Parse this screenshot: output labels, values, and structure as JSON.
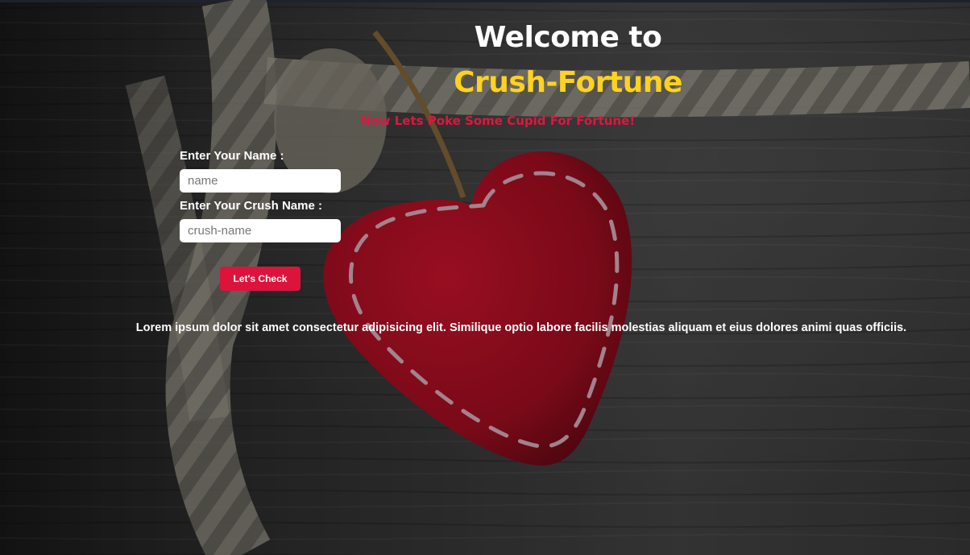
{
  "header": {
    "welcome": "Welcome to",
    "brand": "Crush-Fortune",
    "tagline": "Now Lets Poke Some Cupid For Fortune!"
  },
  "form": {
    "name_label": "Enter Your Name :",
    "name_placeholder": "name",
    "crush_label": "Enter Your Crush Name :",
    "crush_placeholder": "crush-name",
    "submit_label": "Let's Check"
  },
  "body_text": "Lorem ipsum dolor sit amet consectetur adipisicing elit. Similique optio labore facilis molestias aliquam et eius dolores animi quas officiis.",
  "colors": {
    "brand": "#ffd21f",
    "tagline": "#e0163f",
    "button": "#dc143c",
    "heart": "#c8102e"
  }
}
